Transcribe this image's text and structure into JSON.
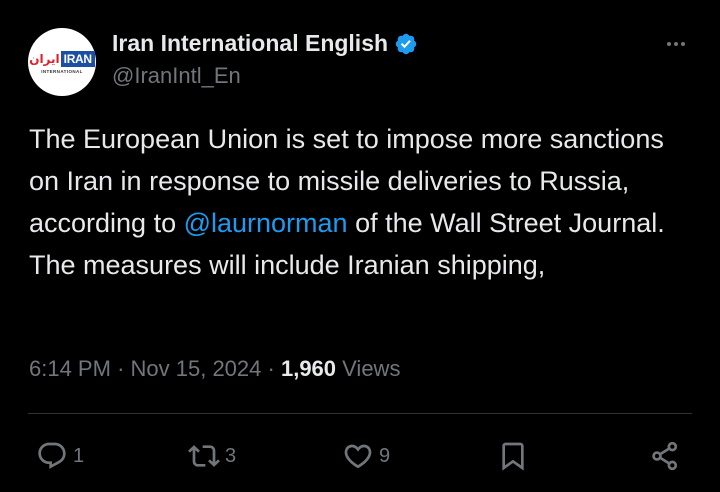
{
  "account": {
    "display_name": "Iran International English",
    "handle": "@IranIntl_En",
    "verified": true,
    "avatar": {
      "logo_fa": "ایران",
      "logo_en": "IRAN",
      "logo_sub": "INTERNATIONAL"
    }
  },
  "more_icon": "more-horizontal-icon",
  "tweet": {
    "text_before": "The European Union is set to impose more sanctions on Iran in response to missile deliveries to Russia, according to ",
    "mention": "@laurnorman",
    "text_after": " of the Wall Street Journal. The measures will include Iranian shipping,"
  },
  "meta": {
    "time": "6:14 PM",
    "separator": "·",
    "date": "Nov 15, 2024",
    "views_count": "1,960",
    "views_label": "Views"
  },
  "actions": {
    "reply": {
      "icon": "reply-icon",
      "count": "1"
    },
    "retweet": {
      "icon": "retweet-icon",
      "count": "3"
    },
    "like": {
      "icon": "heart-icon",
      "count": "9"
    },
    "bookmark": {
      "icon": "bookmark-icon"
    },
    "share": {
      "icon": "share-icon"
    }
  },
  "colors": {
    "background": "#000000",
    "text": "#e7e9ea",
    "secondary": "#71767b",
    "link": "#1d9bf0",
    "divider": "#2f3336",
    "verified_badge": "#1d9bf0"
  }
}
